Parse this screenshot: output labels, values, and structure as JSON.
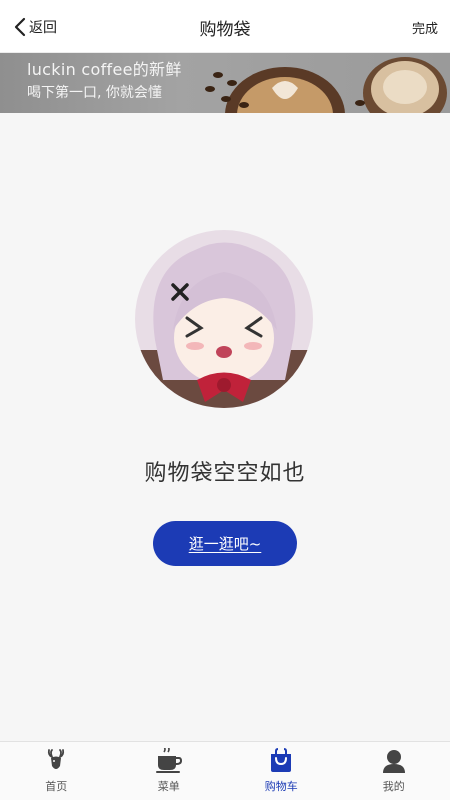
{
  "header": {
    "back_label": "返回",
    "title": "购物袋",
    "done_label": "完成"
  },
  "banner": {
    "line1": "luckin coffee的新鲜",
    "line2": "喝下第一口, 你就会懂"
  },
  "empty": {
    "message": "购物袋空空如也",
    "button_label": "逛一逛吧~"
  },
  "tabbar": {
    "items": [
      {
        "label": "首页",
        "icon": "deer-icon"
      },
      {
        "label": "菜单",
        "icon": "coffee-cup-icon"
      },
      {
        "label": "购物车",
        "icon": "shopping-bag-icon",
        "active": true
      },
      {
        "label": "我的",
        "icon": "user-icon"
      }
    ]
  },
  "colors": {
    "accent": "#1c3bb5",
    "background": "#f6f6f6"
  }
}
